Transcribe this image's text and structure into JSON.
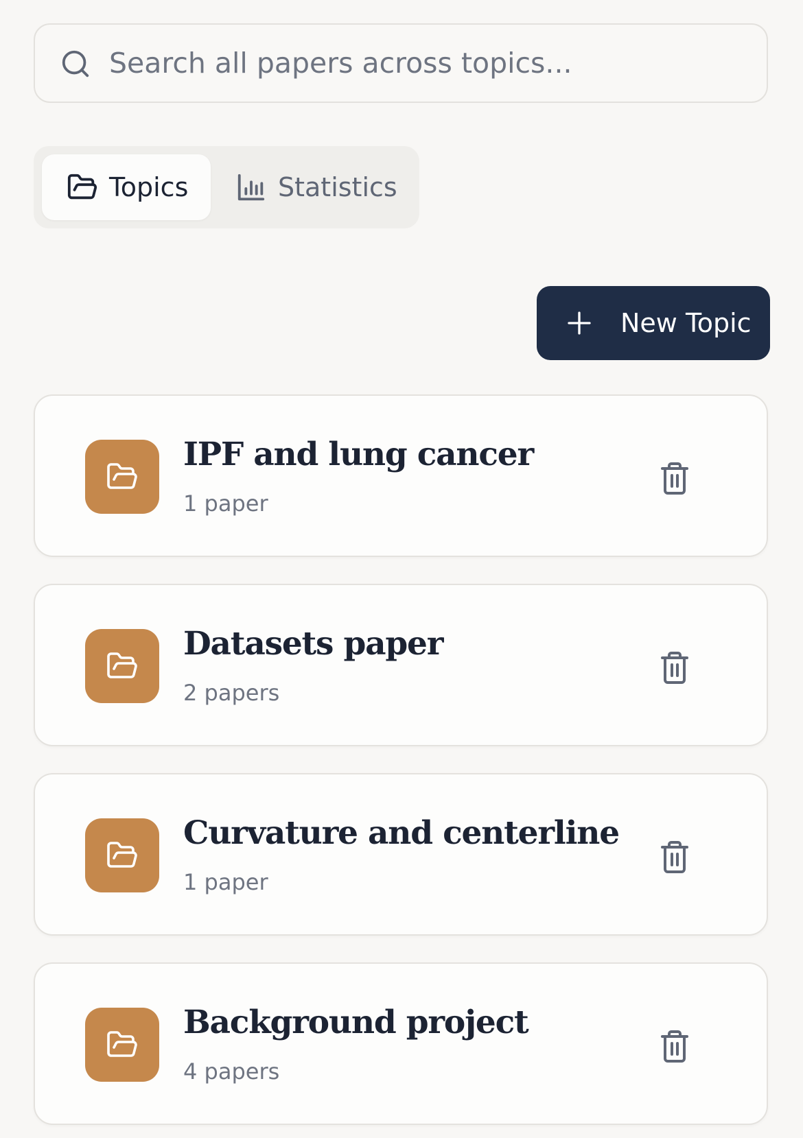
{
  "search": {
    "placeholder": "Search all papers across topics...",
    "value": ""
  },
  "tabs": [
    {
      "label": "Topics",
      "icon": "folder-icon",
      "active": true
    },
    {
      "label": "Statistics",
      "icon": "bar-chart-icon",
      "active": false
    }
  ],
  "toolbar": {
    "new_topic_label": "New Topic"
  },
  "topics": [
    {
      "title": "IPF and lung cancer",
      "count": "1 paper"
    },
    {
      "title": "Datasets paper",
      "count": "2 papers"
    },
    {
      "title": "Curvature and centerline",
      "count": "1 paper"
    },
    {
      "title": "Background project",
      "count": "4 papers"
    }
  ],
  "colors": {
    "accent": "#c5884c",
    "primary_button": "#1f2d46",
    "background": "#f8f7f5"
  }
}
